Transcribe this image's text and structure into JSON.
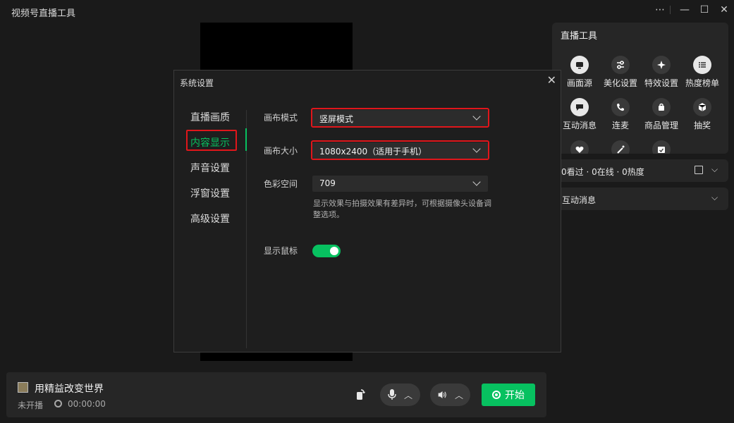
{
  "window": {
    "title": "视频号直播工具",
    "controls": [
      "more-icon",
      "minimize-icon",
      "maximize-icon",
      "close-icon"
    ]
  },
  "right_panel": {
    "tools_title": "直播工具",
    "tools": [
      {
        "label": "画面源",
        "icon": "screen-source-icon"
      },
      {
        "label": "美化设置",
        "icon": "sliders-icon"
      },
      {
        "label": "特效设置",
        "icon": "sparkle-icon"
      },
      {
        "label": "热度榜单",
        "icon": "list-icon"
      },
      {
        "label": "互动消息",
        "icon": "chat-bubble-icon"
      },
      {
        "label": "连麦",
        "icon": "phone-icon"
      },
      {
        "label": "商品管理",
        "icon": "shopping-bag-icon"
      },
      {
        "label": "抽奖",
        "icon": "gift-box-icon"
      }
    ],
    "stats": "0看过 · 0在线 · 0热度",
    "messages_title": "互动消息"
  },
  "bottom_bar": {
    "room_name": "用精益改变世界",
    "status": "未开播",
    "timer": "00:00:00",
    "start_label": "开始"
  },
  "settings_modal": {
    "title": "系统设置",
    "nav": [
      {
        "label": "直播画质",
        "active": false
      },
      {
        "label": "内容显示",
        "active": true
      },
      {
        "label": "声音设置",
        "active": false
      },
      {
        "label": "浮窗设置",
        "active": false
      },
      {
        "label": "高级设置",
        "active": false
      }
    ],
    "canvas_mode": {
      "label": "画布模式",
      "value": "竖屏模式"
    },
    "canvas_size": {
      "label": "画布大小",
      "value": "1080x2400（适用于手机）"
    },
    "color_space": {
      "label": "色彩空间",
      "value": "709"
    },
    "hint": "显示效果与拍摄效果有差异时，可根据摄像头设备调整选项。",
    "show_cursor": {
      "label": "显示鼠标",
      "enabled": true
    },
    "accent_color": "#07c160",
    "highlight_color": "#e0161b"
  }
}
